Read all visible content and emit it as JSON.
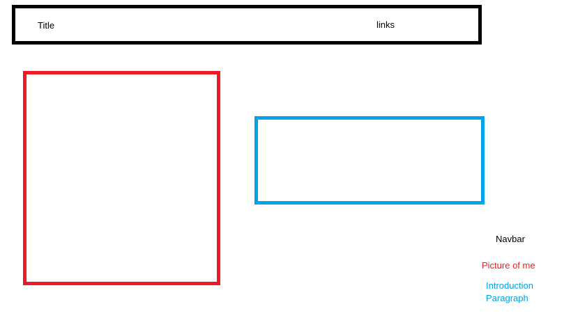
{
  "navbar": {
    "title": "Title",
    "links": "links"
  },
  "legend": {
    "navbar": "Navbar",
    "picture": "Picture of me",
    "intro_line1": "Introduction",
    "intro_line2": "Paragraph"
  },
  "colors": {
    "navbar": "#000000",
    "picture": "#ED1C24",
    "intro": "#00A2E8"
  }
}
